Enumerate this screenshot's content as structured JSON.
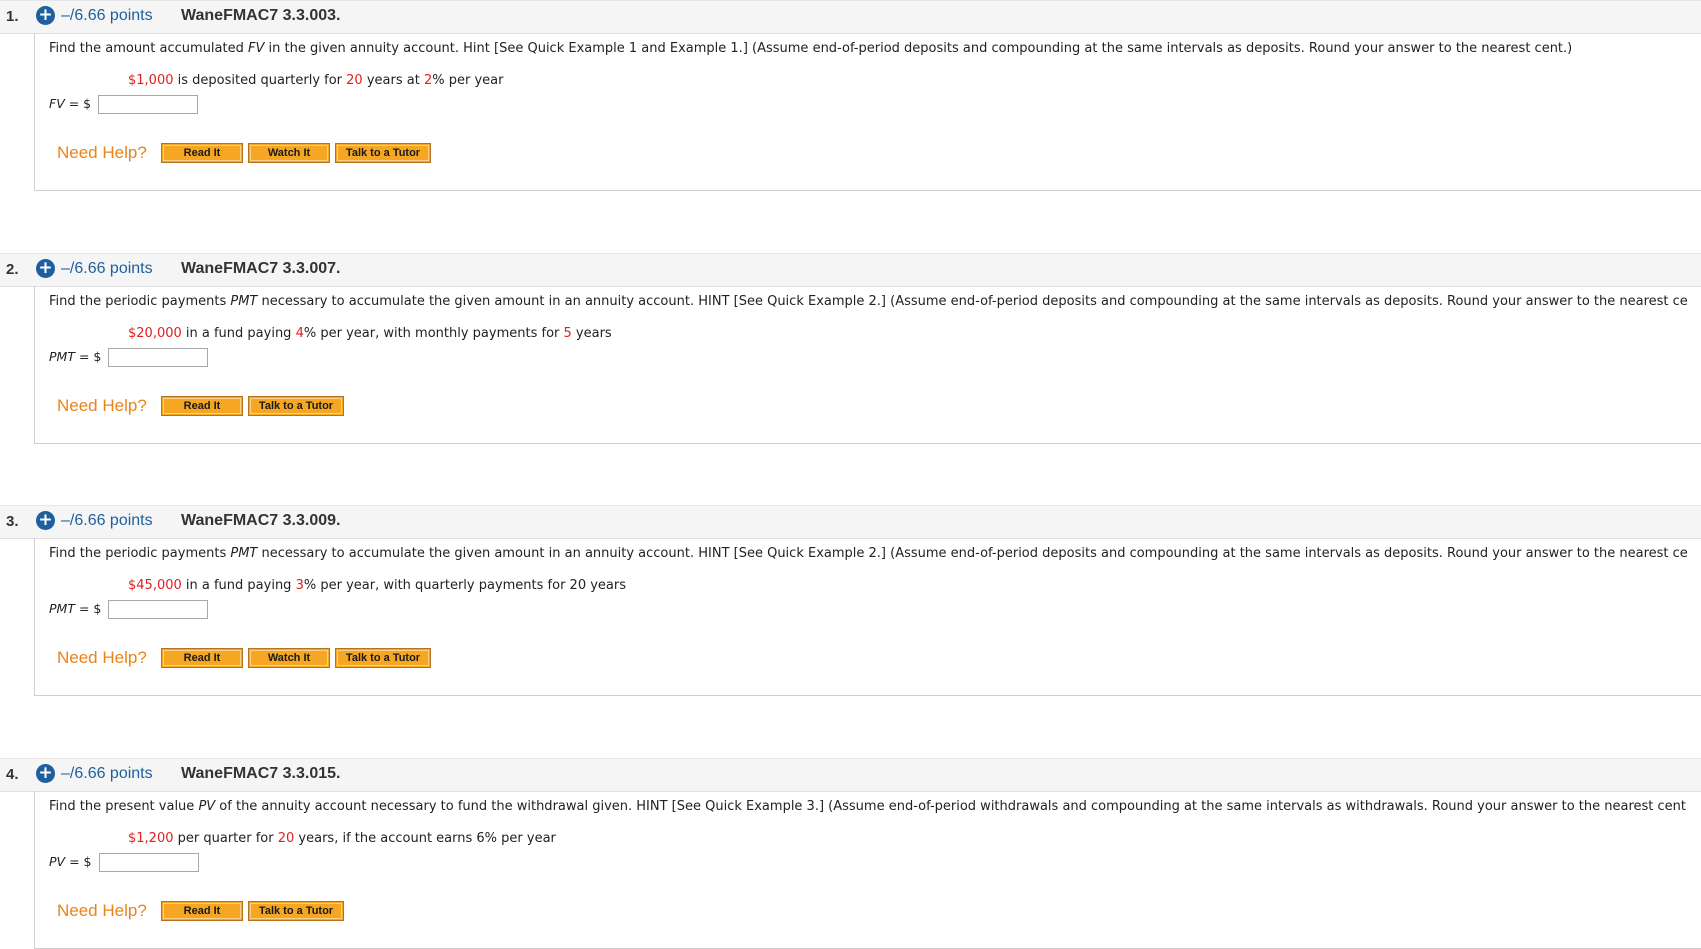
{
  "help": {
    "need_help_label": "Need Help?",
    "read_it": "Read It",
    "watch_it": "Watch It",
    "talk_to_tutor": "Talk to a Tutor"
  },
  "questions": [
    {
      "number": "1.",
      "points": "–/6.66 points",
      "code": "WaneFMAC7 3.3.003.",
      "prompt_pre": "Find the amount accumulated ",
      "prompt_var": "FV",
      "prompt_post": " in the given annuity account. Hint [See Quick Example 1 and Example 1.] (Assume end-of-period deposits and compounding at the same intervals as deposits. Round your answer to the nearest cent.)",
      "given": [
        {
          "text": "$1,000",
          "red": true
        },
        {
          "text": " is deposited quarterly for ",
          "red": false
        },
        {
          "text": "20",
          "red": true
        },
        {
          "text": " years at ",
          "red": false
        },
        {
          "text": "2",
          "red": true
        },
        {
          "text": "% per year",
          "red": false
        }
      ],
      "answer_var": "FV",
      "answer_eq": " = $",
      "answer_value": "",
      "buttons": [
        "read_it",
        "watch_it",
        "talk_to_tutor"
      ]
    },
    {
      "number": "2.",
      "points": "–/6.66 points",
      "code": "WaneFMAC7 3.3.007.",
      "prompt_pre": "Find the periodic payments ",
      "prompt_var": "PMT",
      "prompt_post": " necessary to accumulate the given amount in an annuity account. HINT [See Quick Example 2.] (Assume end-of-period deposits and compounding at the same intervals as deposits. Round your answer to the nearest ce",
      "given": [
        {
          "text": "$20,000",
          "red": true
        },
        {
          "text": " in a fund paying ",
          "red": false
        },
        {
          "text": "4",
          "red": true
        },
        {
          "text": "% per year, with monthly payments for ",
          "red": false
        },
        {
          "text": "5",
          "red": true
        },
        {
          "text": " years",
          "red": false
        }
      ],
      "answer_var": "PMT",
      "answer_eq": " = $",
      "answer_value": "",
      "buttons": [
        "read_it",
        "talk_to_tutor"
      ]
    },
    {
      "number": "3.",
      "points": "–/6.66 points",
      "code": "WaneFMAC7 3.3.009.",
      "prompt_pre": "Find the periodic payments ",
      "prompt_var": "PMT",
      "prompt_post": " necessary to accumulate the given amount in an annuity account. HINT [See Quick Example 2.] (Assume end-of-period deposits and compounding at the same intervals as deposits. Round your answer to the nearest ce",
      "given": [
        {
          "text": "$45,000",
          "red": true
        },
        {
          "text": " in a fund paying ",
          "red": false
        },
        {
          "text": "3",
          "red": true
        },
        {
          "text": "% per year, with quarterly payments for 20 years",
          "red": false
        }
      ],
      "answer_var": "PMT",
      "answer_eq": " = $",
      "answer_value": "",
      "buttons": [
        "read_it",
        "watch_it",
        "talk_to_tutor"
      ]
    },
    {
      "number": "4.",
      "points": "–/6.66 points",
      "code": "WaneFMAC7 3.3.015.",
      "prompt_pre": "Find the present value ",
      "prompt_var": "PV",
      "prompt_post": " of the annuity account necessary to fund the withdrawal given. HINT [See Quick Example 3.] (Assume end-of-period withdrawals and compounding at the same intervals as withdrawals. Round your answer to the nearest cent",
      "given": [
        {
          "text": "$1,200",
          "red": true
        },
        {
          "text": " per quarter for ",
          "red": false
        },
        {
          "text": "20",
          "red": true
        },
        {
          "text": " years, if the account earns 6% per year",
          "red": false
        }
      ],
      "answer_var": "PV",
      "answer_eq": " = $",
      "answer_value": "",
      "buttons": [
        "read_it",
        "talk_to_tutor"
      ]
    }
  ],
  "colors": {
    "points_blue": "#1f5f9e",
    "need_help_orange": "#e88419",
    "highlight_red": "#e0201f",
    "button_orange": "#f5a623"
  }
}
